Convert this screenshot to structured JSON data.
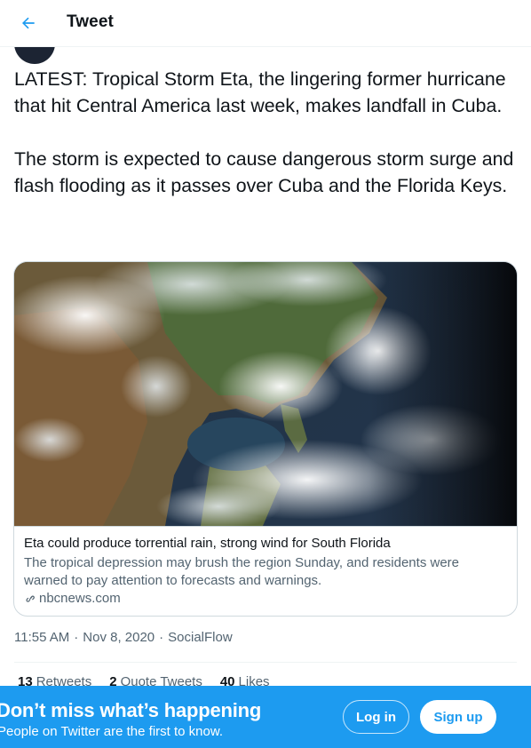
{
  "header": {
    "back_icon": "arrow-left-icon",
    "title": "Tweet"
  },
  "tweet": {
    "text": "LATEST: Tropical Storm Eta, the lingering former hurricane that hit Central America last week, makes landfall in Cuba.\n\nThe storm is expected to cause dangerous storm surge and flash flooding as it passes over Cuba and the Florida Keys.",
    "card": {
      "image_icon": "satellite-image",
      "title": "Eta could produce torrential rain, strong wind for South Florida",
      "description": "The tropical depression may brush the region Sunday, and residents were warned to pay attention to forecasts and warnings.",
      "link_icon": "link-icon",
      "domain": "nbcnews.com"
    },
    "time": "11:55 AM",
    "separator": "·",
    "date": "Nov 8, 2020",
    "source": "SocialFlow",
    "stats": [
      {
        "count": "13",
        "label": "Retweets"
      },
      {
        "count": "2",
        "label": "Quote Tweets"
      },
      {
        "count": "40",
        "label": "Likes"
      }
    ]
  },
  "banner": {
    "title": "Don’t miss what’s happening",
    "subtitle": "People on Twitter are the first to know.",
    "login_label": "Log in",
    "signup_label": "Sign up"
  },
  "colors": {
    "accent": "#1d9bf0",
    "text_primary": "#0f1419",
    "text_secondary": "#536471",
    "border": "#cfd9de"
  }
}
